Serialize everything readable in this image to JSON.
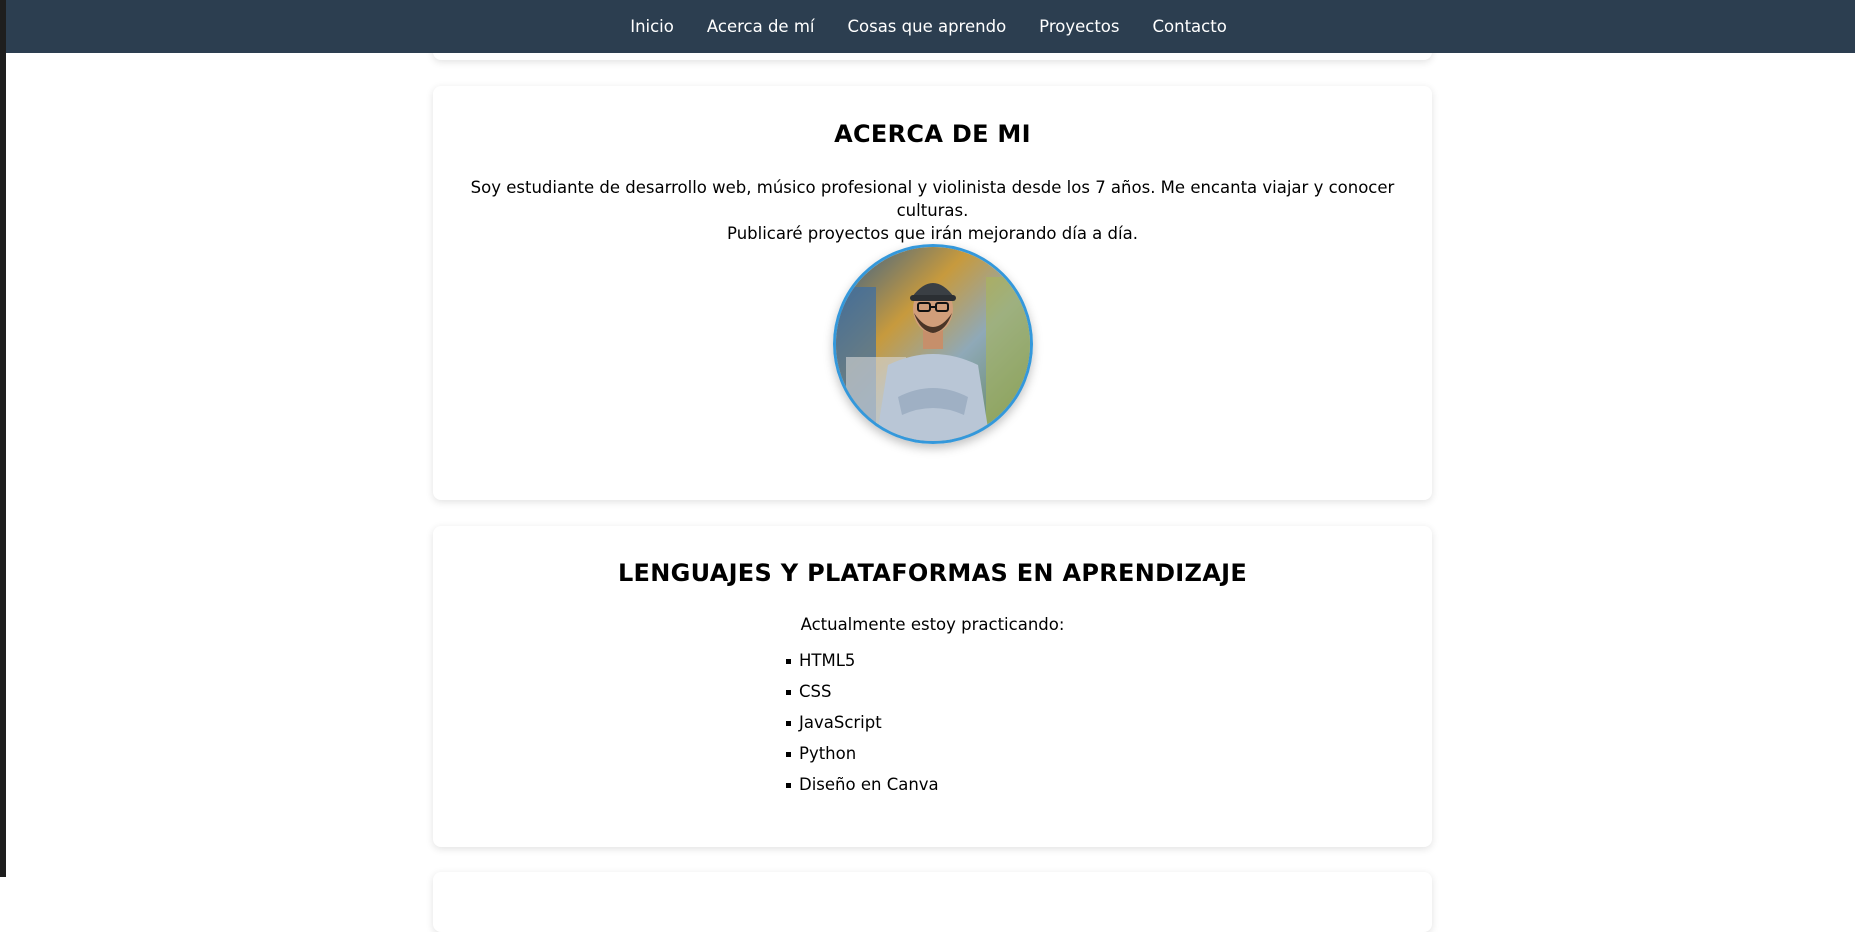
{
  "nav": {
    "items": [
      {
        "label": "Inicio"
      },
      {
        "label": "Acerca de mí"
      },
      {
        "label": "Cosas que aprendo"
      },
      {
        "label": "Proyectos"
      },
      {
        "label": "Contacto"
      }
    ]
  },
  "about": {
    "title": "ACERCA DE MI",
    "line1": "Soy estudiante de desarrollo web, músico profesional y violinista desde los 7 años. Me encanta viajar y conocer culturas.",
    "line2": "Publicaré proyectos que irán mejorando día a día."
  },
  "languages": {
    "title": "LENGUAJES Y PLATAFORMAS EN APRENDIZAJE",
    "intro": "Actualmente estoy practicando:",
    "items": [
      "HTML5",
      "CSS",
      "JavaScript",
      "Python",
      "Diseño en Canva"
    ]
  },
  "colors": {
    "navbar": "#2c3e50",
    "avatar_border": "#3498db"
  }
}
